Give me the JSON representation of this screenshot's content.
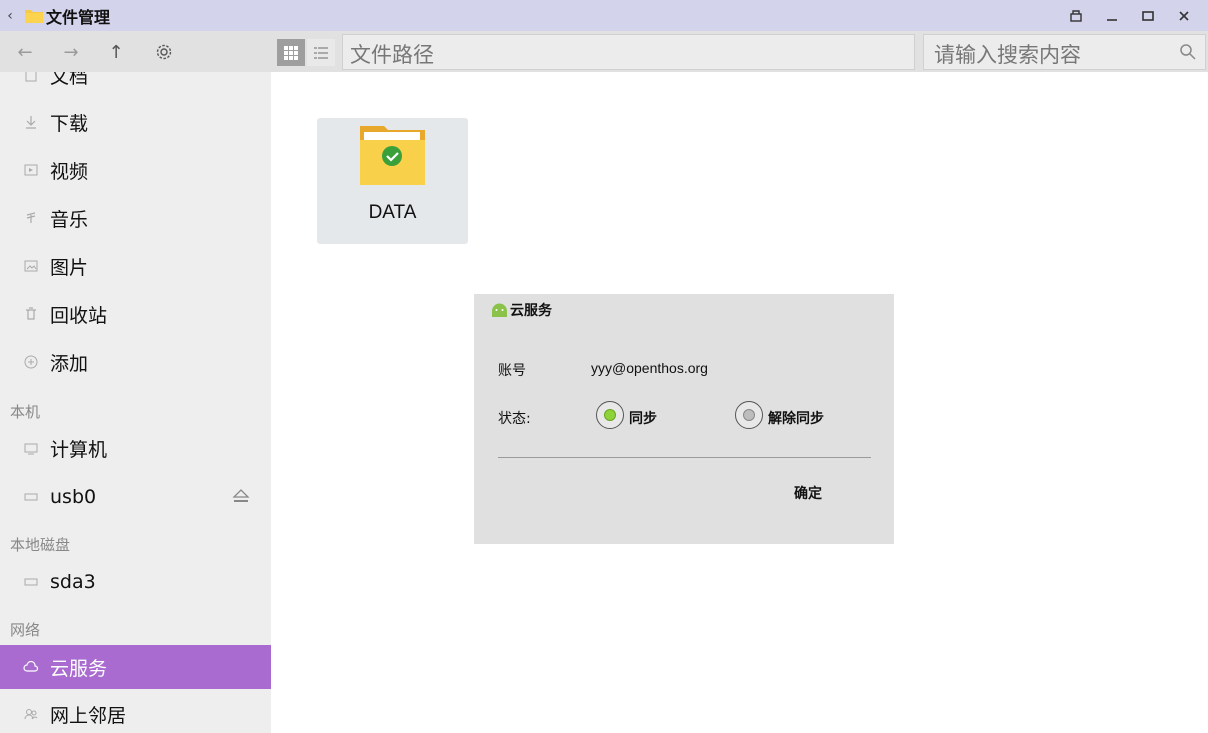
{
  "window": {
    "title": "文件管理",
    "accent": "#d4d3ec"
  },
  "toolbar": {
    "path_placeholder": "文件路径",
    "search_placeholder": "请输入搜索内容"
  },
  "sidebar": {
    "items": [
      {
        "label": "文档",
        "icon": "document-icon"
      },
      {
        "label": "下载",
        "icon": "download-icon"
      },
      {
        "label": "视频",
        "icon": "video-icon"
      },
      {
        "label": "音乐",
        "icon": "music-icon"
      },
      {
        "label": "图片",
        "icon": "image-icon"
      },
      {
        "label": "回收站",
        "icon": "trash-icon"
      },
      {
        "label": "添加",
        "icon": "add-icon"
      }
    ],
    "section_local": "本机",
    "local_items": [
      {
        "label": "计算机",
        "icon": "computer-icon"
      },
      {
        "label": "usb0",
        "icon": "drive-icon"
      }
    ],
    "section_disk": "本地磁盘",
    "disk_items": [
      {
        "label": "sda3",
        "icon": "drive-icon"
      }
    ],
    "section_network": "网络",
    "network_items": [
      {
        "label": "云服务",
        "icon": "cloud-icon",
        "active": true
      },
      {
        "label": "网上邻居",
        "icon": "network-icon"
      }
    ],
    "active_color": "#a96bcf"
  },
  "main": {
    "folders": [
      {
        "name": "DATA",
        "icon": "synced-folder-icon"
      }
    ]
  },
  "dialog": {
    "title": "云服务",
    "account_label": "账号",
    "account_value": "yyy@openthos.org",
    "status_label": "状态:",
    "options": [
      {
        "label": "同步",
        "selected": true
      },
      {
        "label": "解除同步",
        "selected": false
      }
    ],
    "ok_label": "确定"
  }
}
